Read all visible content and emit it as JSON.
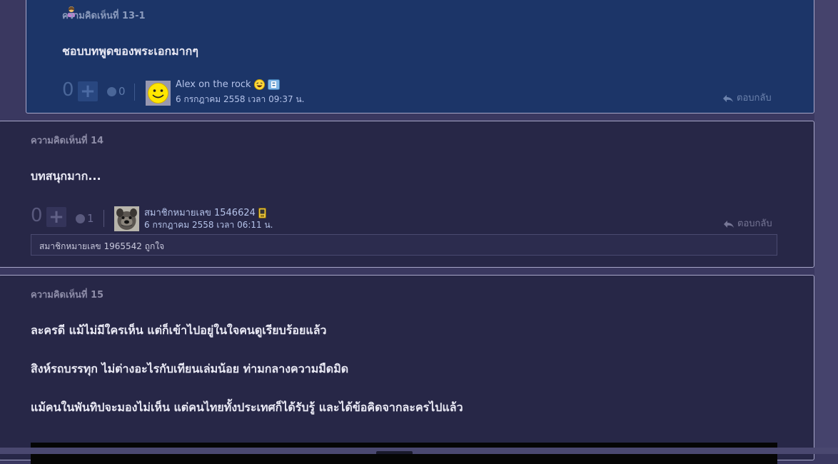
{
  "comments": [
    {
      "number_label": "ความคิดเห็นที่ 13-1",
      "body": [
        "ชอบบทพูดของพระเอกมากๆ"
      ],
      "votes": "0",
      "emote_count": "0",
      "username": "Alex on the rock",
      "timestamp": "6 กรกฎาคม 2558 เวลา 09:37 น.",
      "reply_label": "ตอบกลับ"
    },
    {
      "number_label": "ความคิดเห็นที่ 14",
      "body": [
        "บทสนุกมาก..."
      ],
      "votes": "0",
      "emote_count": "1",
      "username": "สมาชิกหมายเลข 1546624",
      "timestamp": "6 กรกฎาคม 2558 เวลา 06:11 น.",
      "reply_label": "ตอบกลับ",
      "likes_text": "สมาชิกหมายเลข 1965542 ถูกใจ"
    },
    {
      "number_label": "ความคิดเห็นที่ 15",
      "body": [
        "ละครดี  แม้ไม่มีใครเห็น แต่ก็เข้าไปอยู่ในใจคนดูเรียบร้อยแล้ว",
        "สิงห์รถบรรทุก ไม่ต่างอะไรกับเทียนเล่มน้อย ท่ามกลางความมืดมิด",
        "แม้คนในพันทิปจะมองไม่เห็น แต่คนไทยทั้งประเทศก็ได้รับรู้  และได้ข้อคิดจากละครไปแล้ว"
      ]
    }
  ],
  "icons": {
    "plus": "plus-icon",
    "emote": "emotion-icon",
    "reply": "reply-arrow-icon",
    "smiley_avatar": "smiley-face-avatar",
    "dog_avatar": "dog-avatar",
    "laugh_emoji": "laughing-emoji-icon",
    "member_badge": "member-badge-icon",
    "phone_badge": "mobile-phone-icon",
    "user_badge": "female-user-icon"
  },
  "colors": {
    "page_background": "#3a3860",
    "reply_comment_background": "#1c3568",
    "comment_background": "#272747",
    "username_color": "#b5c3ea"
  }
}
